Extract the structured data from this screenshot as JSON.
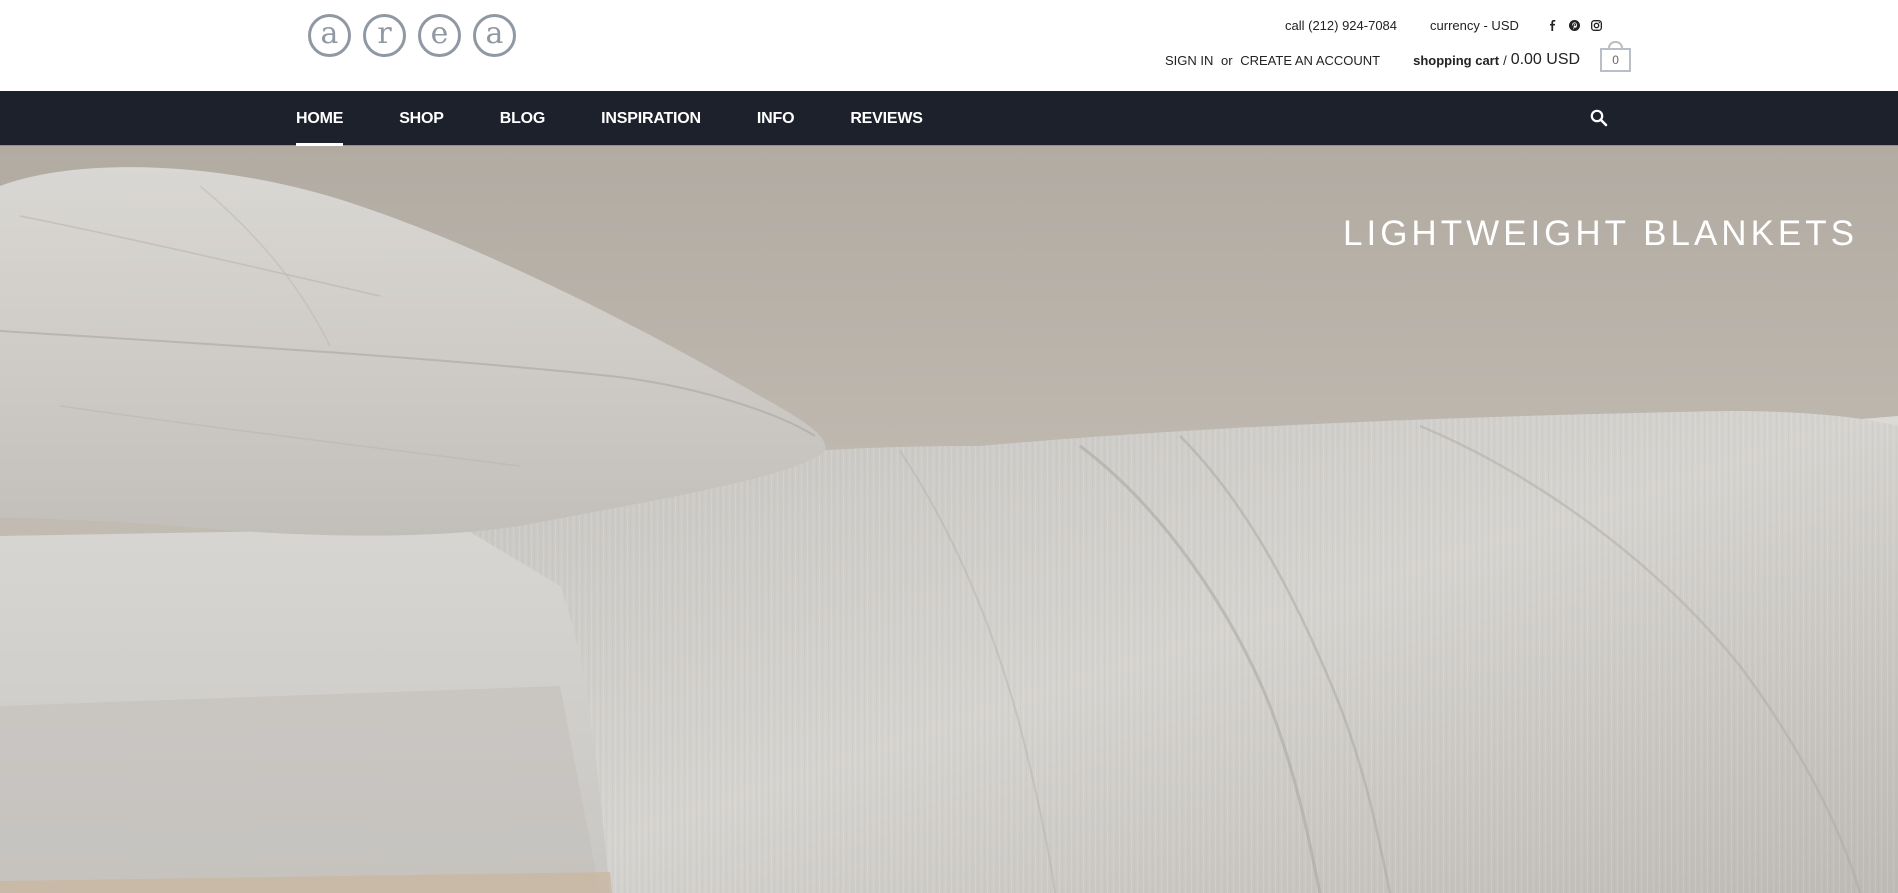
{
  "brand": {
    "logo_letters": [
      "a",
      "r",
      "e",
      "a"
    ],
    "logo_color": "#8f98a3"
  },
  "utility": {
    "phone": "call (212) 924-7084",
    "currency": "currency - USD",
    "social_icons": [
      "facebook-icon",
      "pinterest-icon",
      "instagram-icon"
    ]
  },
  "account": {
    "sign_in": "SIGN IN",
    "or": "or",
    "create": "CREATE AN ACCOUNT"
  },
  "cart": {
    "label": "shopping cart",
    "slash": "/",
    "total": "0.00 USD",
    "count": "0"
  },
  "nav": {
    "items": [
      {
        "label": "HOME",
        "active": true
      },
      {
        "label": "SHOP",
        "active": false
      },
      {
        "label": "BLOG",
        "active": false
      },
      {
        "label": "INSPIRATION",
        "active": false
      },
      {
        "label": "INFO",
        "active": false
      },
      {
        "label": "REVIEWS",
        "active": false
      }
    ],
    "search_icon": "search-icon",
    "background": "#1d212b"
  },
  "hero": {
    "headline": "LIGHTWEIGHT BLANKETS"
  }
}
